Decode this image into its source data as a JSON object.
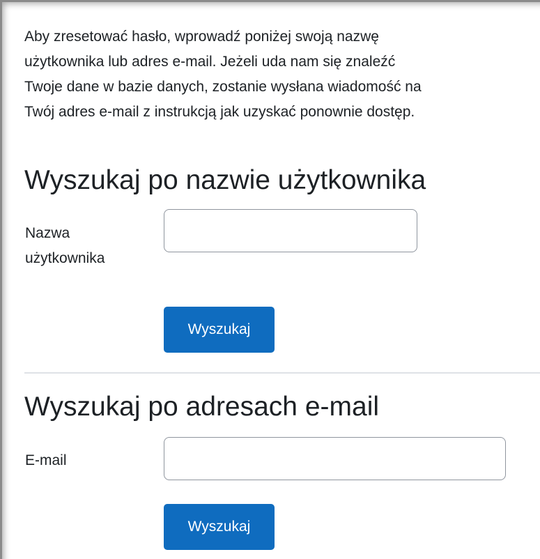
{
  "intro": {
    "line1": "Aby zresetować hasło, wprowadź poniżej swoją nazwę",
    "line2": "użytkownika lub adres e-mail. Jeżeli uda nam się znaleźć",
    "line3": "Twoje dane w bazie danych, zostanie wysłana wiadomość na",
    "line4": "Twój adres e-mail z instrukcją jak uzyskać ponownie dostęp."
  },
  "username_section": {
    "title": "Wyszukaj po nazwie użytkownika",
    "label_line1": "Nazwa",
    "label_line2": "użytkownika",
    "input_value": "",
    "button_label": "Wyszukaj"
  },
  "email_section": {
    "title": "Wyszukaj po adresach e-mail",
    "label": "E-mail",
    "input_value": "",
    "button_label": "Wyszukaj"
  },
  "colors": {
    "primary": "#0f6cbf",
    "text": "#1d2125",
    "input_border": "#8f959e",
    "divider": "#dee2e6"
  }
}
